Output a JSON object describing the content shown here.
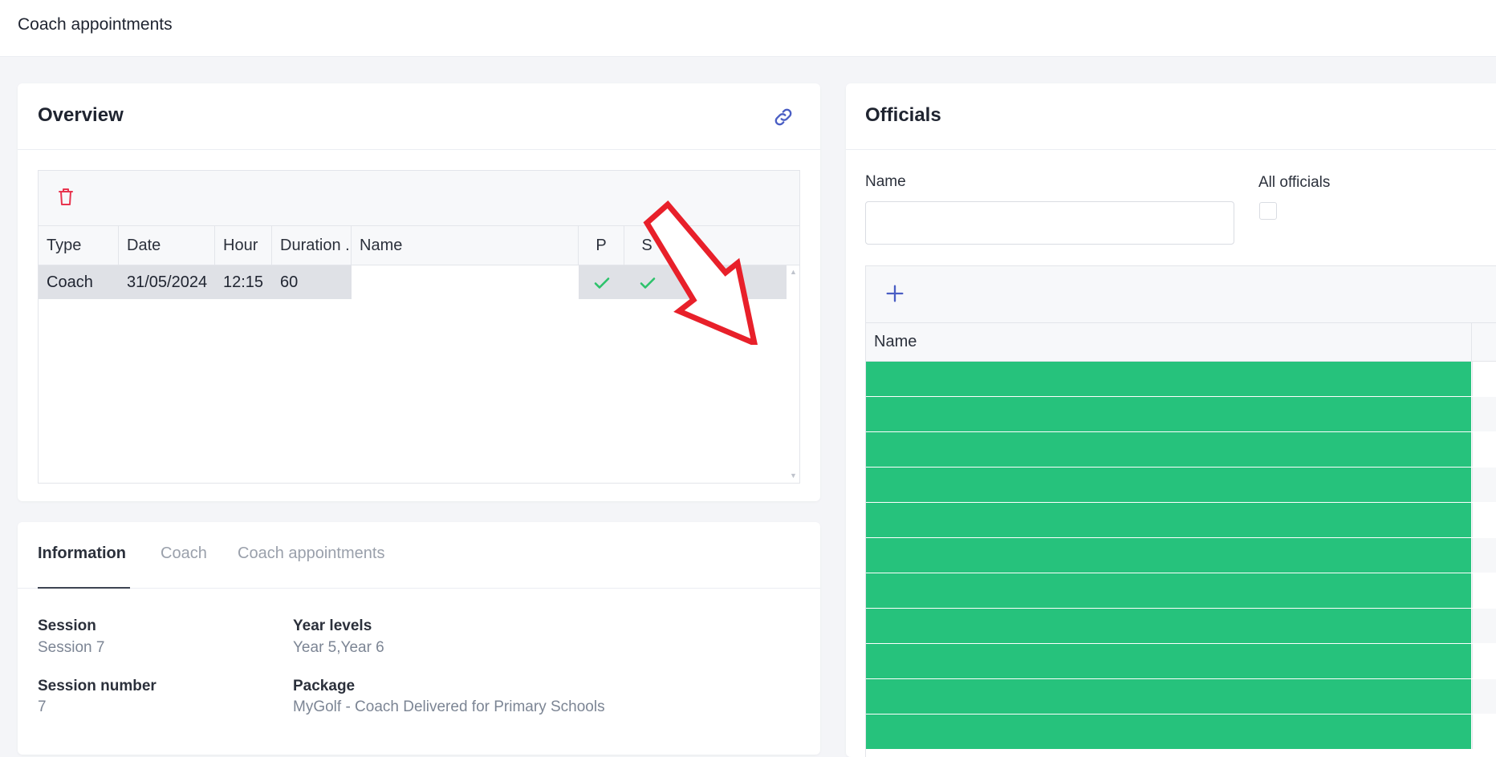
{
  "page": {
    "title": "Coach appointments"
  },
  "overview": {
    "title": "Overview",
    "columns": [
      "Type",
      "Date",
      "Hour",
      "Duration ...",
      "Name",
      "P",
      "S"
    ],
    "rows": [
      {
        "type": "Coach",
        "date": "31/05/2024",
        "hour": "12:15",
        "duration": "60",
        "name": "",
        "p_checked": true,
        "s_checked": true
      }
    ]
  },
  "info": {
    "tabs": [
      "Information",
      "Coach",
      "Coach appointments"
    ],
    "active_tab": "Information",
    "fields": {
      "session_label": "Session",
      "session_value": "Session 7",
      "year_levels_label": "Year levels",
      "year_levels_value": "Year 5,Year 6",
      "session_number_label": "Session number",
      "session_number_value": "7",
      "package_label": "Package",
      "package_value": "MyGolf - Coach Delivered for Primary Schools"
    }
  },
  "officials": {
    "title": "Officials",
    "name_label": "Name",
    "name_value": "",
    "all_officials_label": "All officials",
    "all_officials_checked": false,
    "grid_column": "Name",
    "row_count": 11
  },
  "colors": {
    "accent": "#4a5ec4",
    "danger": "#e8344e",
    "success": "#2dc26b",
    "row_highlight": "#26c27c",
    "annotation": "#e8202a"
  }
}
